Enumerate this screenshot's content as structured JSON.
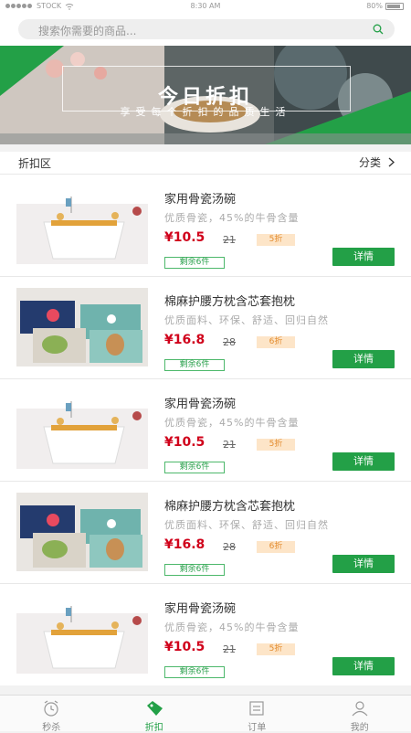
{
  "status_bar": {
    "carrier": "STOCK",
    "time": "8:30 AM",
    "battery": "80%"
  },
  "search": {
    "placeholder": "搜索你需要的商品..."
  },
  "banner": {
    "title": "今日折扣",
    "subtitle": "享受每个折扣的品质生活"
  },
  "section": {
    "title": "折扣区",
    "category_label": "分类"
  },
  "items": [
    {
      "name": "家用骨瓷汤碗",
      "desc": "优质骨瓷，45%的牛骨含量",
      "price": "¥10.5",
      "old_price": "21",
      "discount": "5折",
      "stock": "剩余6件",
      "detail": "详情",
      "image": "bowl-image"
    },
    {
      "name": "棉麻护腰方枕含芯套抱枕",
      "desc": "优质面料、环保、舒适、回归自然",
      "price": "¥16.8",
      "old_price": "28",
      "discount": "6折",
      "stock": "剩余6件",
      "detail": "详情",
      "image": "pillow-image"
    },
    {
      "name": "家用骨瓷汤碗",
      "desc": "优质骨瓷，45%的牛骨含量",
      "price": "¥10.5",
      "old_price": "21",
      "discount": "5折",
      "stock": "剩余6件",
      "detail": "详情",
      "image": "bowl-image"
    },
    {
      "name": "棉麻护腰方枕含芯套抱枕",
      "desc": "优质面料、环保、舒适、回归自然",
      "price": "¥16.8",
      "old_price": "28",
      "discount": "6折",
      "stock": "剩余6件",
      "detail": "详情",
      "image": "pillow-image"
    },
    {
      "name": "家用骨瓷汤碗",
      "desc": "优质骨瓷，45%的牛骨含量",
      "price": "¥10.5",
      "old_price": "21",
      "discount": "5折",
      "stock": "剩余6件",
      "detail": "详情",
      "image": "bowl-image"
    }
  ],
  "tabbar": {
    "tabs": [
      {
        "label": "秒杀",
        "icon": "clock-icon"
      },
      {
        "label": "折扣",
        "icon": "tag-icon"
      },
      {
        "label": "订单",
        "icon": "order-icon"
      },
      {
        "label": "我的",
        "icon": "user-icon"
      }
    ],
    "active_index": 1
  },
  "colors": {
    "accent": "#23a047",
    "price": "#d0021b",
    "discount_bg": "#fde5c8"
  }
}
